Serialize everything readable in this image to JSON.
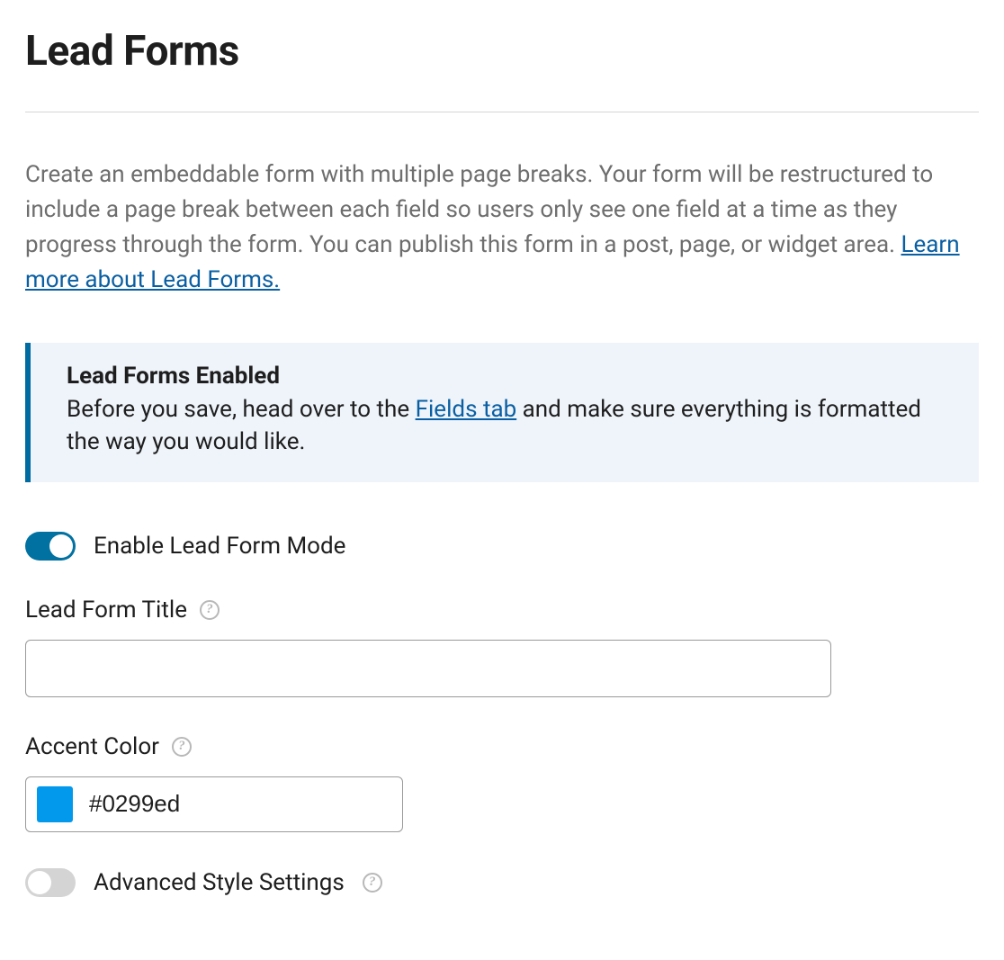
{
  "page": {
    "title": "Lead Forms",
    "description_prefix": "Create an embeddable form with multiple page breaks. Your form will be restructured to include a page break between each field so users only see one field at a time as they progress through the form. You can publish this form in a post, page, or widget area. ",
    "learn_more_label": "Learn more about Lead Forms."
  },
  "notice": {
    "title": "Lead Forms Enabled",
    "body_prefix": "Before you save, head over to the ",
    "link_label": "Fields tab",
    "body_suffix": " and make sure everything is formatted the way you would like."
  },
  "toggle_enable": {
    "label": "Enable Lead Form Mode",
    "state": "on"
  },
  "fields": {
    "title": {
      "label": "Lead Form Title",
      "value": ""
    },
    "accent_color": {
      "label": "Accent Color",
      "value": "#0299ed"
    }
  },
  "toggle_advanced": {
    "label": "Advanced Style Settings",
    "state": "off"
  },
  "help_icon_glyph": "?"
}
